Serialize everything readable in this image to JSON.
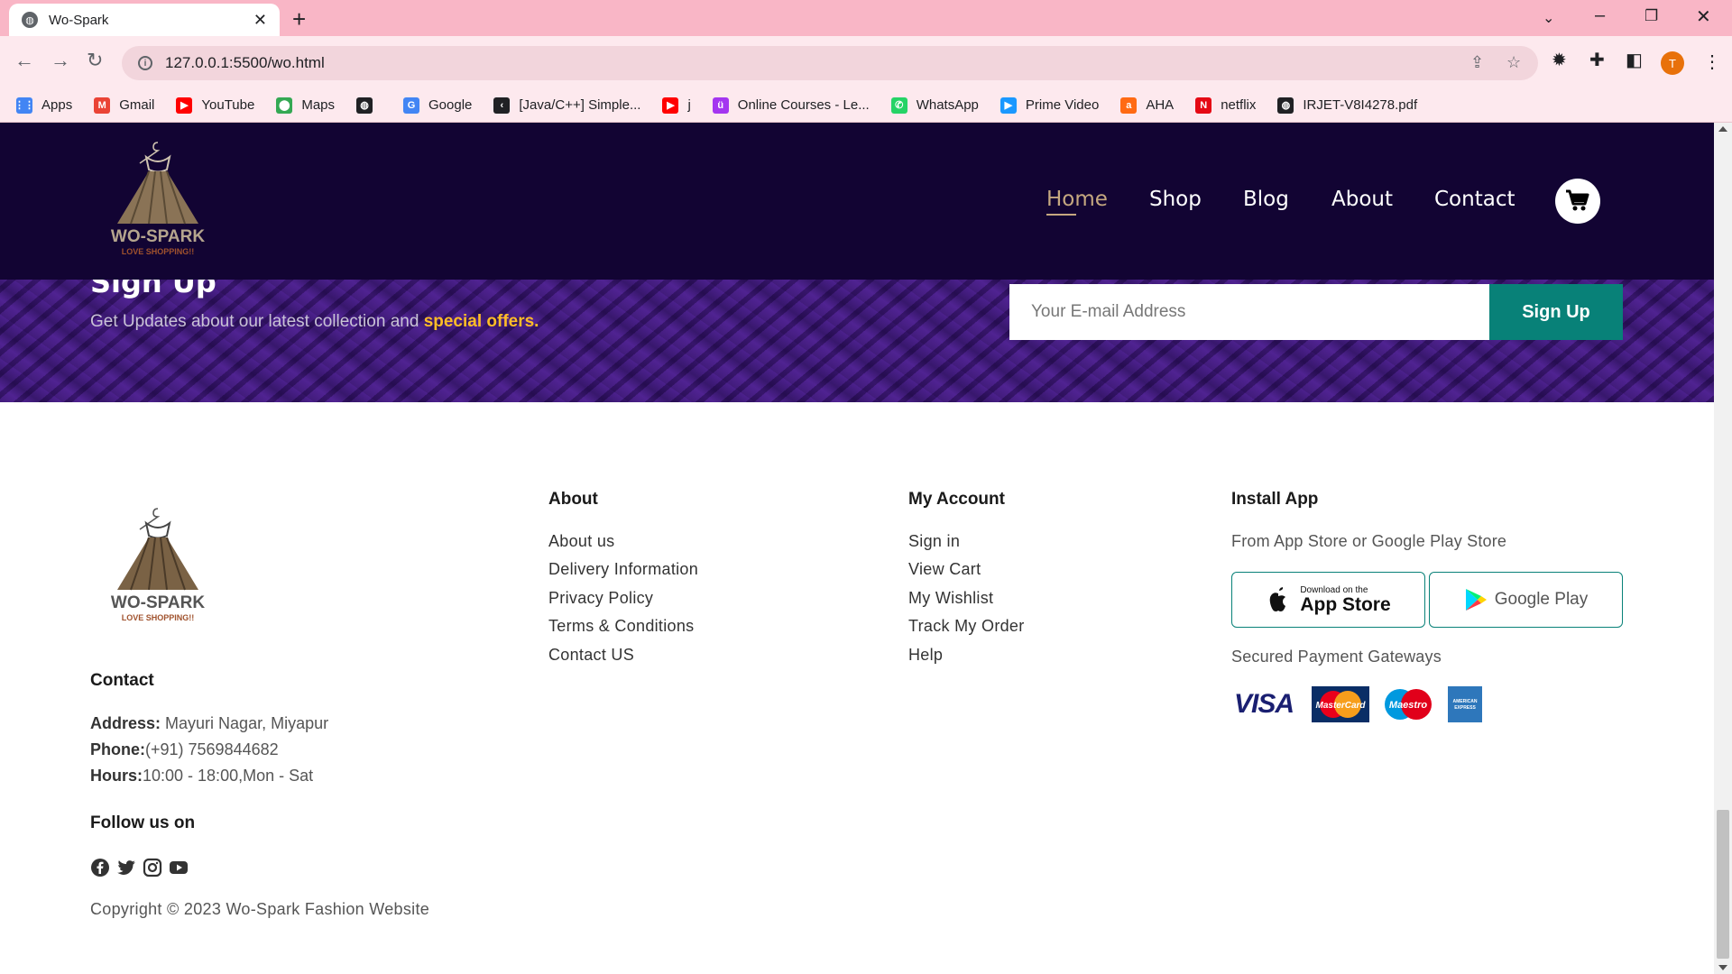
{
  "browser": {
    "tab_title": "Wo-Spark",
    "url": "127.0.0.1:5500/wo.html",
    "profile_initial": "T",
    "bookmarks": [
      {
        "label": "Apps",
        "icon": "apps-grid-icon",
        "color": "#4285f4"
      },
      {
        "label": "Gmail",
        "icon": "gmail-icon",
        "color": "#ea4335"
      },
      {
        "label": "YouTube",
        "icon": "youtube-icon",
        "color": "#ff0000"
      },
      {
        "label": "Maps",
        "icon": "maps-pin-icon",
        "color": "#34a853"
      },
      {
        "label": "",
        "icon": "globe-icon",
        "color": "#202124"
      },
      {
        "label": "Google",
        "icon": "google-icon",
        "color": "#4285f4"
      },
      {
        "label": "[Java/C++] Simple...",
        "icon": "codepen-icon",
        "color": "#202124"
      },
      {
        "label": "j",
        "icon": "youtube-icon",
        "color": "#ff0000"
      },
      {
        "label": "Online Courses - Le...",
        "icon": "udemy-icon",
        "color": "#a435f0"
      },
      {
        "label": "WhatsApp",
        "icon": "whatsapp-icon",
        "color": "#25d366"
      },
      {
        "label": "Prime Video",
        "icon": "prime-video-icon",
        "color": "#1a98ff"
      },
      {
        "label": "AHA",
        "icon": "aha-icon",
        "color": "#ff6a13"
      },
      {
        "label": "netflix",
        "icon": "netflix-icon",
        "color": "#e50914"
      },
      {
        "label": "IRJET-V8I4278.pdf",
        "icon": "globe-icon",
        "color": "#202124"
      }
    ]
  },
  "header": {
    "logo_text": "WO-SPARK",
    "logo_tagline": "LOVE SHOPPING!!",
    "nav": [
      "Home",
      "Shop",
      "Blog",
      "About",
      "Contact"
    ],
    "active_nav": "Home",
    "active_color": "#c5a880",
    "background": "#120433"
  },
  "newsletter": {
    "title": "Sign Up",
    "text_prefix": "Get Updates about our latest collection and ",
    "text_highlight": "special offers.",
    "input_placeholder": "Your E-mail Address",
    "button_label": "Sign Up",
    "button_color": "#088178"
  },
  "footer": {
    "contact": {
      "heading": "Contact",
      "address_label": "Address:",
      "address_value": " Mayuri Nagar, Miyapur",
      "phone_label": "Phone:",
      "phone_value": "(+91) 7569844682",
      "hours_label": "Hours:",
      "hours_value": "10:00 - 18:00,Mon - Sat"
    },
    "follow_heading": "Follow us on",
    "social": [
      "facebook-icon",
      "twitter-icon",
      "instagram-icon",
      "youtube-icon"
    ],
    "copyright": "Copyright © 2023 Wo-Spark Fashion Website",
    "about": {
      "heading": "About",
      "links": [
        "About us",
        "Delivery Information",
        "Privacy Policy",
        "Terms & Conditions",
        "Contact US"
      ]
    },
    "account": {
      "heading": "My Account",
      "links": [
        "Sign in",
        "View Cart",
        "My Wishlist",
        "Track My Order",
        "Help"
      ]
    },
    "install": {
      "heading": "Install App",
      "subtitle": "From App Store or Google Play Store",
      "appstore_small": "Download on the",
      "appstore_big": "App Store",
      "googleplay": "Google Play",
      "payments_heading": "Secured Payment Gateways",
      "payments": [
        "VISA",
        "MasterCard",
        "Maestro",
        "AMERICAN EXPRESS"
      ]
    }
  }
}
